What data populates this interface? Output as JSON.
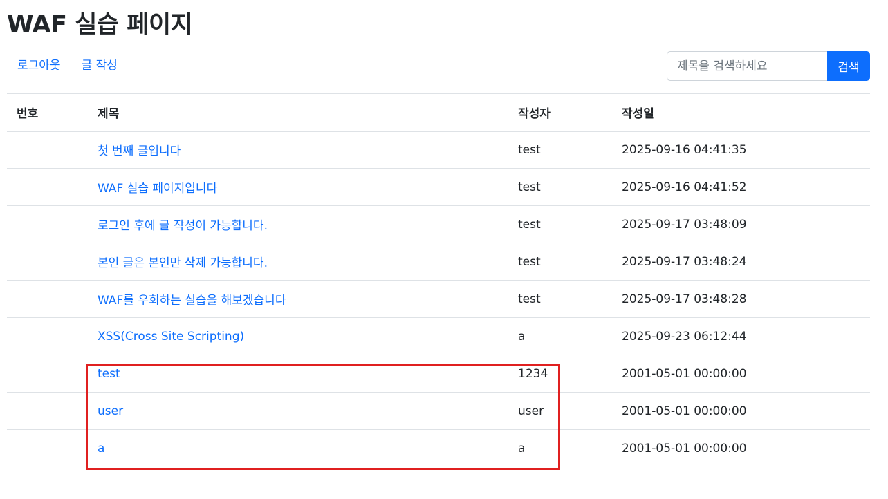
{
  "page": {
    "title": "WAF 실습 페이지"
  },
  "nav": {
    "logout_label": "로그아웃",
    "write_label": "글 작성"
  },
  "search": {
    "placeholder": "제목을 검색하세요",
    "value": "",
    "button_label": "검색"
  },
  "table": {
    "headers": {
      "number": "번호",
      "title": "제목",
      "author": "작성자",
      "date": "작성일"
    },
    "rows": [
      {
        "number": "",
        "title": "첫 번째 글입니다",
        "author": "test",
        "date": "2025-09-16 04:41:35"
      },
      {
        "number": "",
        "title": "WAF 실습 페이지입니다",
        "author": "test",
        "date": "2025-09-16 04:41:52"
      },
      {
        "number": "",
        "title": "로그인 후에 글 작성이 가능합니다.",
        "author": "test",
        "date": "2025-09-17 03:48:09"
      },
      {
        "number": "",
        "title": "본인 글은 본인만 삭제 가능합니다.",
        "author": "test",
        "date": "2025-09-17 03:48:24"
      },
      {
        "number": "",
        "title": "WAF를 우회하는 실습을 해보겠습니다",
        "author": "test",
        "date": "2025-09-17 03:48:28"
      },
      {
        "number": "",
        "title": "XSS(Cross Site Scripting)",
        "author": "a",
        "date": "2025-09-23 06:12:44"
      },
      {
        "number": "",
        "title": "test",
        "author": "1234",
        "date": "2001-05-01 00:00:00"
      },
      {
        "number": "",
        "title": "user",
        "author": "user",
        "date": "2001-05-01 00:00:00"
      },
      {
        "number": "",
        "title": "a",
        "author": "a",
        "date": "2001-05-01 00:00:00"
      }
    ]
  },
  "colors": {
    "link": "#0d6efd",
    "button_bg": "#0d6efd",
    "highlight": "#e02020",
    "border": "#dee2e6"
  }
}
